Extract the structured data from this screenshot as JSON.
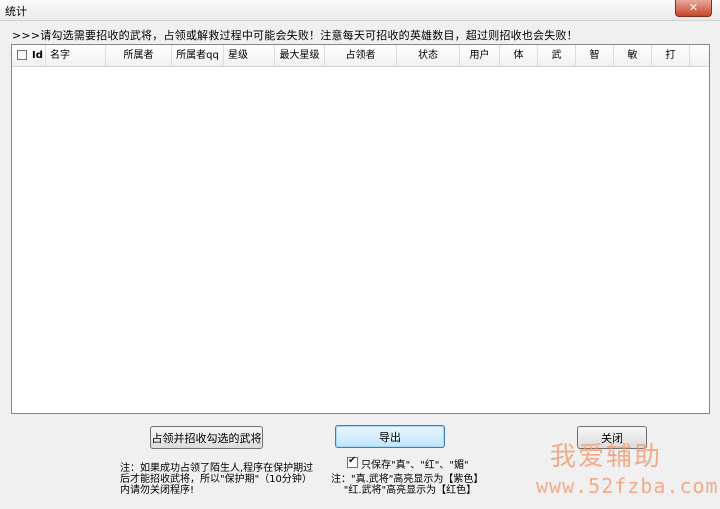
{
  "window": {
    "title": "统计",
    "close_glyph": "✕"
  },
  "notice": ">>>请勾选需要招收的武将，占领或解救过程中可能会失败！注意每天可招收的英雄数目，超过则招收也会失败！",
  "table": {
    "columns": [
      "Id",
      "名字",
      "所属者",
      "所属者qq",
      "星级",
      "最大星级",
      "占领者",
      "状态",
      "用户",
      "体",
      "武",
      "智",
      "敏",
      "打"
    ],
    "rows": []
  },
  "buttons": {
    "occupy": "占领并招收勾选的武将",
    "export": "导出",
    "close": "关闭"
  },
  "only_save": {
    "label": "只保存\"真\"、\"红\"、\"媚\"",
    "checked": true
  },
  "note_left": "注：如果成功占领了陌生人,程序在保护期过\n后才能招收武将，所以\"保护期\"（10分钟）\n内请勿关闭程序!",
  "note_right": "注：\"真.武将\"高亮显示为【紫色】\n    \"红.武将\"高亮显示为【红色】",
  "watermark": {
    "cn": "我爱辅助",
    "url": "www.52fzba.com"
  }
}
